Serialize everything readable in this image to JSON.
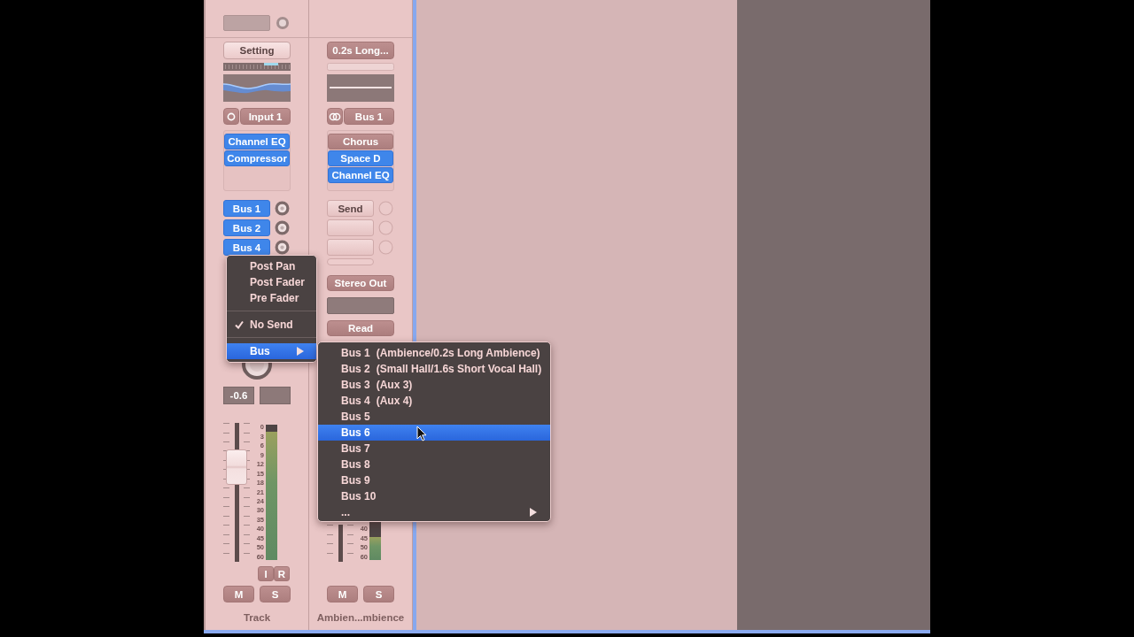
{
  "mixer": {
    "channels": [
      {
        "top_field": true,
        "setting": {
          "label": "Setting",
          "dimmed": false
        },
        "eq_curve": true,
        "input": {
          "label": "Input 1",
          "stereo": false
        },
        "inserts": [
          {
            "label": "Channel EQ",
            "active": true
          },
          {
            "label": "Compressor",
            "active": true
          }
        ],
        "sends": [
          {
            "label": "Bus 1",
            "active": true
          },
          {
            "label": "Bus 2",
            "active": true
          },
          {
            "label": "Bus 4",
            "active": true
          }
        ],
        "pan_knob": true,
        "volume": "-0.6",
        "fader": {
          "level": 0.74
        },
        "meter": {
          "level": 0.95
        },
        "meter_scale": [
          "0",
          "3",
          "6",
          "9",
          "12",
          "15",
          "18",
          "21",
          "24",
          "30",
          "35",
          "40",
          "45",
          "50",
          "60"
        ],
        "io_buttons": [
          "I",
          "R"
        ],
        "mute_solo": [
          "M",
          "S"
        ],
        "name": "Track"
      },
      {
        "setting": {
          "label": "0.2s Long...",
          "dimmed": true
        },
        "eq_curve": false,
        "input": {
          "label": "Bus 1",
          "stereo": true
        },
        "inserts": [
          {
            "label": "Chorus",
            "active": false
          },
          {
            "label": "Space D",
            "active": true
          },
          {
            "label": "Channel EQ",
            "active": true
          }
        ],
        "sends": [
          {
            "label": "Send",
            "active": false
          },
          {
            "active": false
          },
          {
            "active": false
          }
        ],
        "new_send_slot": true,
        "output": "Stereo Out",
        "group_field": true,
        "automation": "Read",
        "meter": {
          "level": 0.17
        },
        "meter_scale": [
          "40",
          "45",
          "50",
          "60"
        ],
        "mute_solo": [
          "M",
          "S"
        ],
        "name": "Ambien...mbience"
      }
    ]
  },
  "context_menu": {
    "items": [
      {
        "kind": "item",
        "label": "Post Pan",
        "checked": false,
        "selected": false,
        "submenu": false
      },
      {
        "kind": "item",
        "label": "Post Fader",
        "checked": false,
        "selected": false,
        "submenu": false
      },
      {
        "kind": "item",
        "label": "Pre Fader",
        "checked": false,
        "selected": false,
        "submenu": false
      },
      {
        "kind": "separator"
      },
      {
        "kind": "item",
        "label": "No Send",
        "checked": true,
        "selected": false,
        "submenu": false
      },
      {
        "kind": "separator"
      },
      {
        "kind": "item",
        "label": "Bus",
        "checked": false,
        "selected": true,
        "submenu": true
      }
    ]
  },
  "submenu": {
    "items": [
      {
        "label": "Bus 1",
        "detail": "(Ambience/0.2s Long Ambience)",
        "selected": false,
        "submenu": false
      },
      {
        "label": "Bus 2",
        "detail": "(Small Hall/1.6s Short Vocal Hall)",
        "selected": false,
        "submenu": false
      },
      {
        "label": "Bus 3",
        "detail": "(Aux 3)",
        "selected": false,
        "submenu": false
      },
      {
        "label": "Bus 4",
        "detail": "(Aux 4)",
        "selected": false,
        "submenu": false
      },
      {
        "label": "Bus 5",
        "selected": false,
        "submenu": false
      },
      {
        "label": "Bus 6",
        "selected": true,
        "submenu": false
      },
      {
        "label": "Bus 7",
        "selected": false,
        "submenu": false
      },
      {
        "label": "Bus 8",
        "selected": false,
        "submenu": false
      },
      {
        "label": "Bus 9",
        "selected": false,
        "submenu": false
      },
      {
        "label": "Bus 10",
        "selected": false,
        "submenu": false
      },
      {
        "label": "...",
        "selected": false,
        "submenu": true
      }
    ]
  }
}
